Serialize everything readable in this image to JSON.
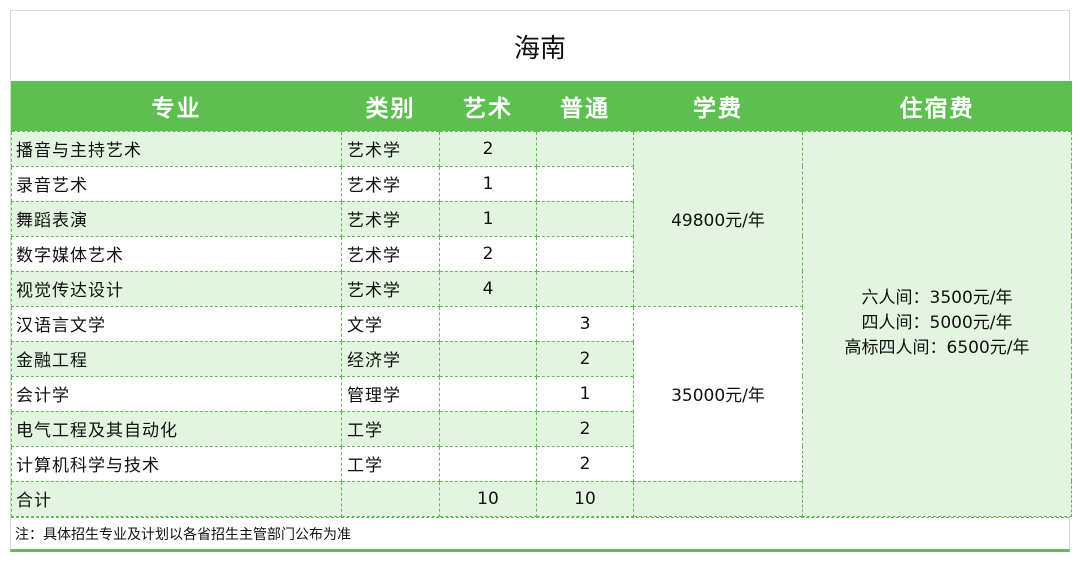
{
  "title": "海南",
  "headers": [
    "专业",
    "类别",
    "艺术",
    "普通",
    "学费",
    "住宿费"
  ],
  "rows": [
    {
      "major": "播音与主持艺术",
      "category": "艺术学",
      "art": "2",
      "general": ""
    },
    {
      "major": "录音艺术",
      "category": "艺术学",
      "art": "1",
      "general": ""
    },
    {
      "major": "舞蹈表演",
      "category": "艺术学",
      "art": "1",
      "general": ""
    },
    {
      "major": "数字媒体艺术",
      "category": "艺术学",
      "art": "2",
      "general": ""
    },
    {
      "major": "视觉传达设计",
      "category": "艺术学",
      "art": "4",
      "general": ""
    },
    {
      "major": "汉语言文学",
      "category": "文学",
      "art": "",
      "general": "3"
    },
    {
      "major": "金融工程",
      "category": "经济学",
      "art": "",
      "general": "2"
    },
    {
      "major": "会计学",
      "category": "管理学",
      "art": "",
      "general": "1"
    },
    {
      "major": "电气工程及其自动化",
      "category": "工学",
      "art": "",
      "general": "2"
    },
    {
      "major": "计算机科学与技术",
      "category": "工学",
      "art": "",
      "general": "2"
    }
  ],
  "tuition": {
    "art": "49800元/年",
    "general": "35000元/年"
  },
  "dorm": {
    "line1": "六人间：3500元/年",
    "line2": "四人间：5000元/年",
    "line3": "高标四人间：6500元/年"
  },
  "total": {
    "label": "合计",
    "art": "10",
    "general": "10"
  },
  "note": "注：具体招生专业及计划以各省招生主管部门公布为准",
  "colors": {
    "header_green": "#5cbf50",
    "row_light_green": "#e3f5e1"
  }
}
